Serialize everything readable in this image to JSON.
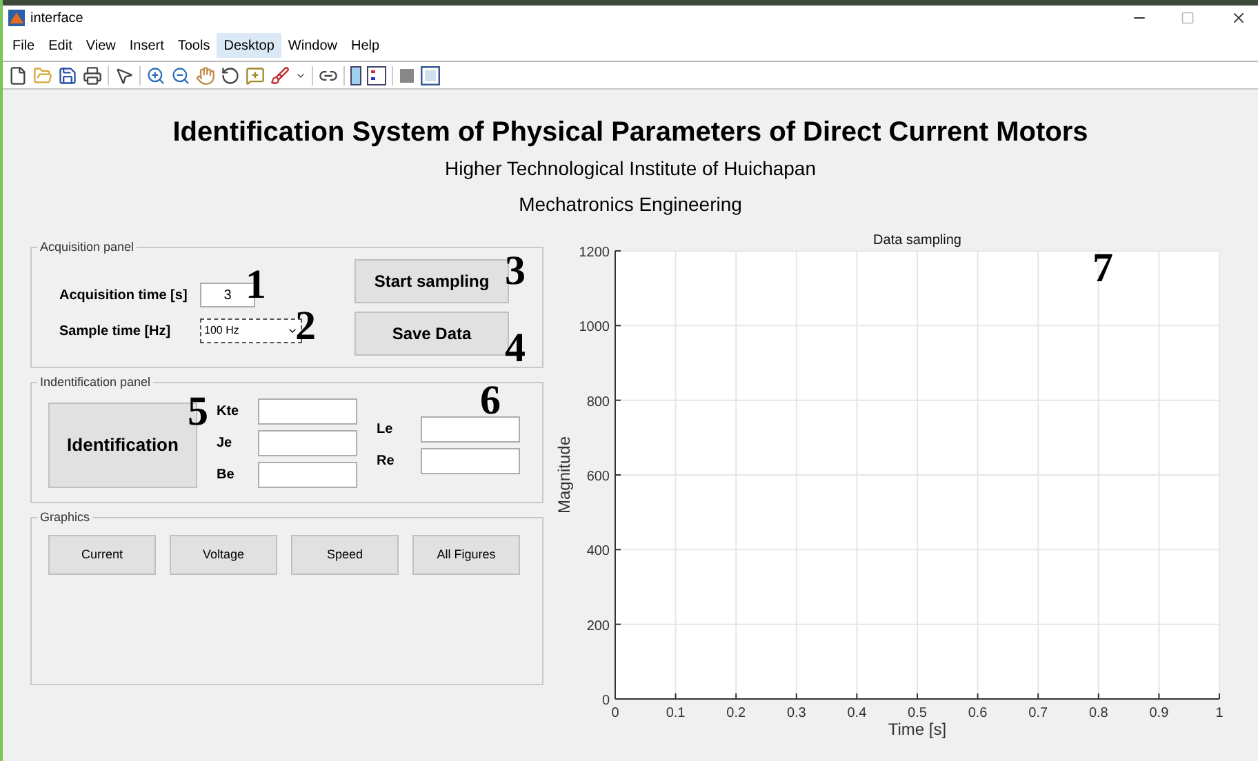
{
  "window": {
    "title": "interface"
  },
  "menu": [
    {
      "label": "File",
      "selected": false
    },
    {
      "label": "Edit",
      "selected": false
    },
    {
      "label": "View",
      "selected": false
    },
    {
      "label": "Insert",
      "selected": false
    },
    {
      "label": "Tools",
      "selected": false
    },
    {
      "label": "Desktop",
      "selected": true
    },
    {
      "label": "Window",
      "selected": false
    },
    {
      "label": "Help",
      "selected": false
    }
  ],
  "heading": "Identification System of Physical Parameters of Direct Current Motors",
  "subtitles": [
    "Higher Technological Institute of Huichapan",
    "Mechatronics Engineering"
  ],
  "acquisition_panel": {
    "title": "Acquisition panel",
    "acquisition_time": {
      "label": "Acquisition time [s]",
      "value": "3"
    },
    "sample_time": {
      "label": "Sample time [Hz]",
      "value": "100 Hz"
    },
    "buttons": [
      "Start sampling",
      "Save Data"
    ]
  },
  "identification_panel": {
    "title": "Indentification panel",
    "button": "Identification",
    "fields_left": [
      {
        "label": "Kte"
      },
      {
        "label": "Je"
      },
      {
        "label": "Be"
      }
    ],
    "fields_right": [
      {
        "label": "Le"
      },
      {
        "label": "Re"
      }
    ]
  },
  "graphics_panel": {
    "title": "Graphics",
    "buttons": [
      "Current",
      "Voltage",
      "Speed",
      "All Figures"
    ]
  },
  "chart": {
    "chart_data": {
      "type": "line",
      "title": "Data sampling",
      "xlabel": "Time [s]",
      "ylabel": "Magnitude",
      "xlim": [
        0,
        1
      ],
      "ylim": [
        0,
        1200
      ],
      "xticks": [
        0,
        0.1,
        0.2,
        0.3,
        0.4,
        0.5,
        0.6,
        0.7,
        0.8,
        0.9,
        1
      ],
      "yticks": [
        0,
        200,
        400,
        600,
        800,
        1000,
        1200
      ],
      "grid": true
    }
  },
  "callouts": [
    "1",
    "2",
    "3",
    "4",
    "5",
    "6",
    "7"
  ]
}
